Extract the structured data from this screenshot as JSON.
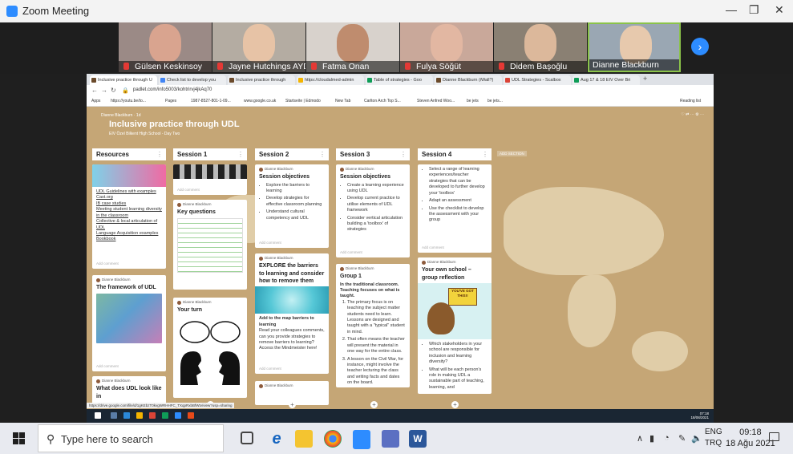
{
  "window": {
    "title": "Zoom Meeting",
    "minimize": "—",
    "restore": "❐",
    "close": "✕"
  },
  "participants": [
    {
      "name": "Gülsen Keskinsoy",
      "bg": "#9b8a86",
      "face": "#d9a48f"
    },
    {
      "name": "Jayne Hutchings AYDIN",
      "bg": "#b4aca2",
      "face": "#e7c3a6"
    },
    {
      "name": "Fatma Onan",
      "bg": "#d8d2cc",
      "face": "#bf8c6e"
    },
    {
      "name": "Fulya Söğüt",
      "bg": "#c9a89a",
      "face": "#e2b7a2"
    },
    {
      "name": "Didem Başoğlu",
      "bg": "#8a8073",
      "face": "#dcb89b"
    },
    {
      "name": "Dianne Blackburn",
      "bg": "#9aa7b3",
      "face": "#e7c9ad"
    }
  ],
  "next_icon": "chevron-right-icon",
  "browser": {
    "tabs": [
      "Inclusive practice through U",
      "Check list to develop you",
      "Inclusive practice through",
      "https://cloudalmed-admin",
      "Table of strategies - Goo",
      "Dianne Blackburn (iWall?)",
      "UDL Strategies - Scalbox",
      "Aug 17 & 18 EIV Over Bri"
    ],
    "url": "padlet.com/info5003/kohtrirvj4jkAq70",
    "bookmarks": [
      "Apps",
      "https://youtu.be/to...",
      "Pages",
      "1987-8527-801-1-09...",
      "www.google.co.uk",
      "Startseite | Edmodo",
      "New Tab",
      "Carlton Arch Top S...",
      "Steven Anfred Woo...",
      "be jets",
      "be jets...",
      "Reading list"
    ]
  },
  "padlet": {
    "author": "Dianne Blackburn · 1d",
    "title": "Inclusive practice through UDL",
    "subtitle": "EIV Özel Bilkent High School - Day Two",
    "add_section": "ADD SECTION",
    "columns": [
      "Resources",
      "Session 1",
      "Session 2",
      "Session 3",
      "Session 4"
    ],
    "resources_links": [
      "UDL Guidelines with examples",
      "Cast.org",
      "IB case studies",
      "Meeting student learning diversity in the classroom",
      "Collective & local articulation of UDL",
      "Language Acquisition examples",
      "Bookbook"
    ],
    "card_author": "Dianne Blackburn",
    "framework_title": "The framework of UDL",
    "udl_look_title": "What does UDL look like in",
    "key_questions": "Key questions",
    "your_turn": "Your turn",
    "s2_objectives_title": "Session objectives",
    "s2_objectives": [
      "Explore the barriers to learning",
      "Develop strategies for effective classroom planning",
      "Understand cultural competency and UDL"
    ],
    "s2_explore_title": "EXPLORE the barriers to learning and consider how to remove them",
    "s2_map_title": "Add to the map barriers to learning",
    "s2_map_text": "Read your colleagues comments, can you provide strategies to remove barriers to learning? Access the Mindmeister here!",
    "s3_objectives_title": "Session objectives",
    "s3_objectives": [
      "Create a learning experience using UDL",
      "Develop current practice to utilise elements of UDL framework",
      "Consider vertical articulation building a 'toolbox' of strategies"
    ],
    "s3_group_title": "Group 1",
    "s3_group_sub": "In the traditional classroom. Teaching focuses on what is taught.",
    "s3_group_items": [
      "The primary focus is on teaching the subject matter students need to learn. Lessons are designed and taught with a \"typical\" student in mind.",
      "That often means the teacher will present the material in one way for the entire class.",
      "A lesson on the Civil War, for instance, might involve the teacher lecturing the class and writing facts and dates on the board."
    ],
    "s4_items": [
      "Select a range of learning experiences/teacher strategies that can be developed to further develop your 'toolbox'",
      "Adapt an assessment",
      "Use the checklist to develop the assessment with your group"
    ],
    "s4_reflection_title": "Your own school – group reflection",
    "s4_owl_text": "YOU'VE GOT THIS!!",
    "s4_bottom_items": [
      "Which stakeholders in your school are responsible for inclusion and learning diversity?",
      "What will be each person's role in making UDL a sustainable part of teaching, learning, and"
    ],
    "add_comment": "Add comment"
  },
  "remote_taskbar": {
    "status_url": "https://drive.google.com/file/d/1gKEbzT0kvgWRHHFC_TXqpRxbBfWtv/view?usp=sharing",
    "time": "07:18",
    "date": "18/08/2021"
  },
  "taskbar": {
    "search_placeholder": "Type here to search",
    "lang_top": "ENG",
    "lang_bottom": "TRQ",
    "time": "09:18",
    "date": "18 Ağu 2021"
  }
}
